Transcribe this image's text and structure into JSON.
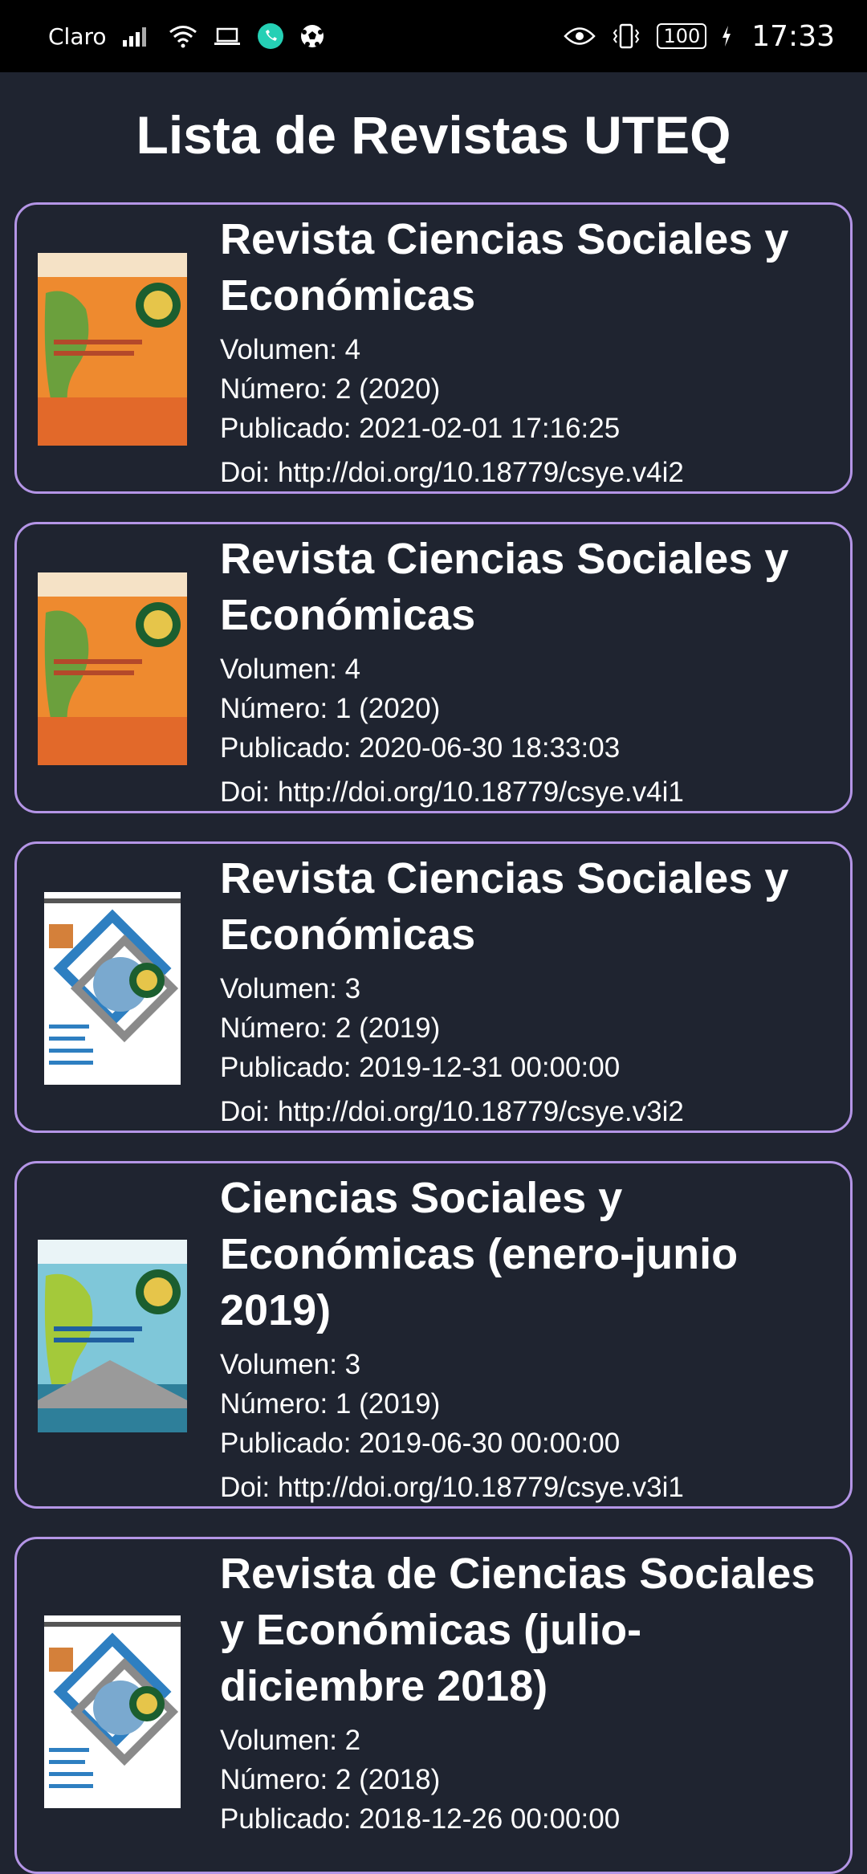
{
  "status_bar": {
    "carrier": "Claro",
    "battery": "100",
    "time": "17:33",
    "icons": [
      "signal-icon",
      "wifi-icon",
      "laptop-icon",
      "whatsapp-icon",
      "soccer-ball-icon",
      "eye-icon",
      "vibrate-icon",
      "charging-icon"
    ]
  },
  "page": {
    "title": "Lista de Revistas UTEQ"
  },
  "colors": {
    "background": "#1f2430",
    "card_border": "#b495e6",
    "status_bar": "#000000",
    "text": "#ffffff"
  },
  "journals": [
    {
      "title": "Revista Ciencias Sociales y Económicas",
      "volume": "Volumen: 4",
      "number": "Número: 2 (2020)",
      "published": "Publicado: 2021-02-01 17:16:25",
      "doi": "Doi: http://doi.org/10.18779/csye.v4i2",
      "cover": "orange-cover"
    },
    {
      "title": "Revista Ciencias Sociales y Económicas",
      "volume": "Volumen: 4",
      "number": "Número: 1 (2020)",
      "published": "Publicado: 2020-06-30 18:33:03",
      "doi": "Doi: http://doi.org/10.18779/csye.v4i1",
      "cover": "orange-cover"
    },
    {
      "title": "Revista Ciencias Sociales y Económicas",
      "volume": "Volumen: 3",
      "number": "Número: 2 (2019)",
      "published": "Publicado: 2019-12-31 00:00:00",
      "doi": "Doi: http://doi.org/10.18779/csye.v3i2",
      "cover": "white-cover"
    },
    {
      "title": "Ciencias Sociales y Económicas (enero-junio 2019)",
      "volume": "Volumen: 3",
      "number": "Número: 1 (2019)",
      "published": "Publicado: 2019-06-30 00:00:00",
      "doi": "Doi: http://doi.org/10.18779/csye.v3i1",
      "cover": "blue-cover"
    },
    {
      "title": "Revista de Ciencias Sociales y Económicas (julio-diciembre 2018)",
      "volume": "Volumen: 2",
      "number": "Número: 2 (2018)",
      "published": "Publicado: 2018-12-26 00:00:00",
      "doi": "",
      "cover": "white-cover"
    }
  ]
}
